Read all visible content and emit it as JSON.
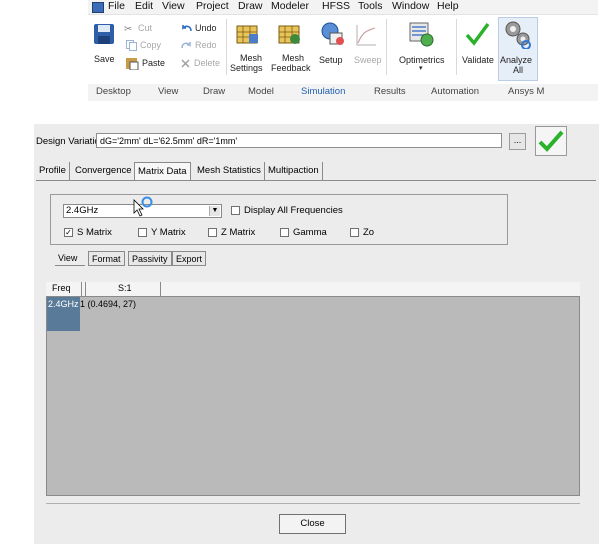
{
  "menu": [
    "File",
    "Edit",
    "View",
    "Project",
    "Draw",
    "Modeler",
    "HFSS",
    "Tools",
    "Window",
    "Help"
  ],
  "toolbar": {
    "save": "Save",
    "cut": "Cut",
    "copy": "Copy",
    "paste": "Paste",
    "undo": "Undo",
    "redo": "Redo",
    "delete": "Delete",
    "mesh_settings_1": "Mesh",
    "mesh_settings_2": "Settings",
    "mesh_feedback_1": "Mesh",
    "mesh_feedback_2": "Feedback",
    "setup": "Setup",
    "sweep": "Sweep",
    "optimetrics": "Optimetrics",
    "validate": "Validate",
    "analyze_1": "Analyze",
    "analyze_2": "All"
  },
  "ribbon_tabs": [
    "Desktop",
    "View",
    "Draw",
    "Model",
    "Simulation",
    "Results",
    "Automation",
    "Ansys M"
  ],
  "active_ribbon_tab": "Simulation",
  "dialog": {
    "design_variation_label": "Design Variation:",
    "design_variation_value": "dG='2mm' dL='62.5mm' dR='1mm'",
    "browse_button": "...",
    "tabs": [
      "Profile",
      "Convergence",
      "Matrix Data",
      "Mesh Statistics",
      "Multipaction"
    ],
    "active_tab": "Matrix Data",
    "frequency_selected": "2.4GHz",
    "display_all_frequencies": "Display All Frequencies",
    "matrix_options": [
      {
        "label": "S Matrix",
        "checked": true
      },
      {
        "label": "Y Matrix",
        "checked": false
      },
      {
        "label": "Z Matrix",
        "checked": false
      },
      {
        "label": "Gamma",
        "checked": false
      },
      {
        "label": "Zo",
        "checked": false
      }
    ],
    "sub_tabs": [
      "View",
      "Format",
      "Passivity",
      "Export"
    ],
    "active_sub_tab": "View",
    "grid": {
      "headers": [
        "Freq",
        "S:1"
      ],
      "rows": [
        {
          "freq": "2.4GHz",
          "s1": "1 (0.4694,      27)"
        }
      ]
    },
    "close_button": "Close"
  },
  "colors": {
    "accent_blue": "#1f5fb4",
    "check_green": "#2bb22b",
    "grid_background": "#bababa",
    "selected_row_head": "#5a7a9a"
  }
}
